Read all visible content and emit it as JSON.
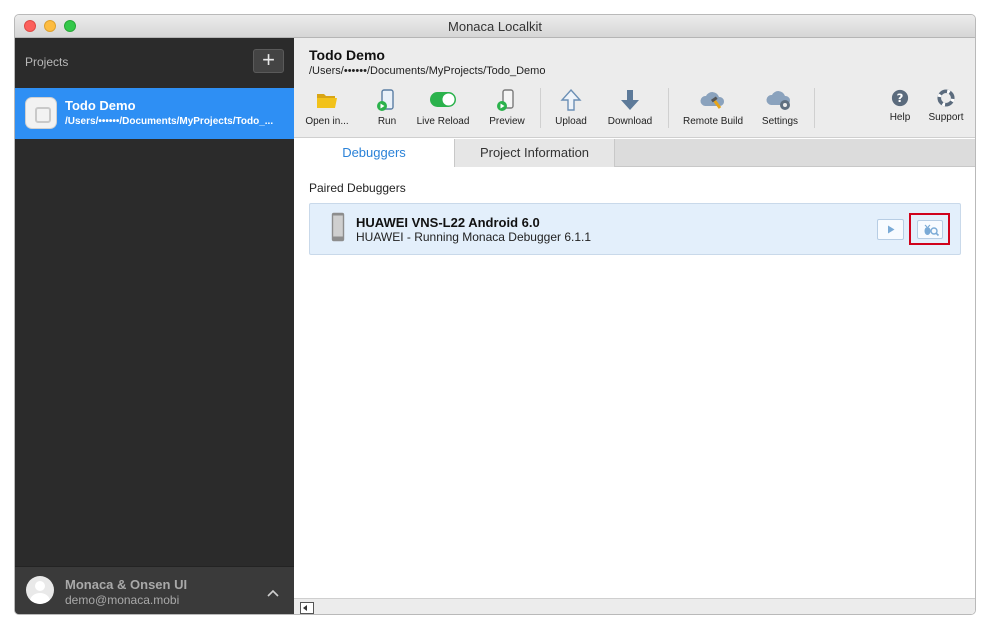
{
  "window": {
    "title": "Monaca Localkit"
  },
  "sidebar": {
    "title": "Projects",
    "add_label": "+",
    "projects": [
      {
        "name": "Todo Demo",
        "path": "/Users/••••••/Documents/MyProjects/Todo_..."
      }
    ],
    "user": {
      "name": "Monaca & Onsen UI",
      "email": "demo@monaca.mobi"
    },
    "footer_caret": "^"
  },
  "main": {
    "title": "Todo Demo",
    "path": "/Users/••••••/Documents/MyProjects/Todo_Demo",
    "toolbar": {
      "open": "Open in...",
      "run": "Run",
      "live_reload": "Live Reload",
      "preview": "Preview",
      "upload": "Upload",
      "download": "Download",
      "remote_build": "Remote Build",
      "settings": "Settings",
      "help": "Help",
      "support": "Support"
    },
    "tabs": [
      {
        "label": "Debuggers",
        "active": true
      },
      {
        "label": "Project Information",
        "active": false
      }
    ],
    "paired_label": "Paired Debuggers",
    "device": {
      "name": "HUAWEI VNS-L22 Android 6.0",
      "status": "HUAWEI - Running Monaca Debugger 6.1.1"
    }
  },
  "colors": {
    "accent": "#2e8ff4",
    "sidebar_bg": "#2b2b2b",
    "highlight": "#d0021b",
    "toggle_on": "#2bb24c"
  },
  "icons": {
    "open": "folder-icon",
    "run": "phone-play-icon",
    "live_reload": "toggle-switch-icon",
    "preview": "phone-preview-icon",
    "upload": "arrow-up-icon",
    "download": "arrow-down-icon",
    "remote_build": "cloud-build-icon",
    "settings": "cloud-gear-icon",
    "help": "help-icon",
    "support": "lifebuoy-icon"
  }
}
